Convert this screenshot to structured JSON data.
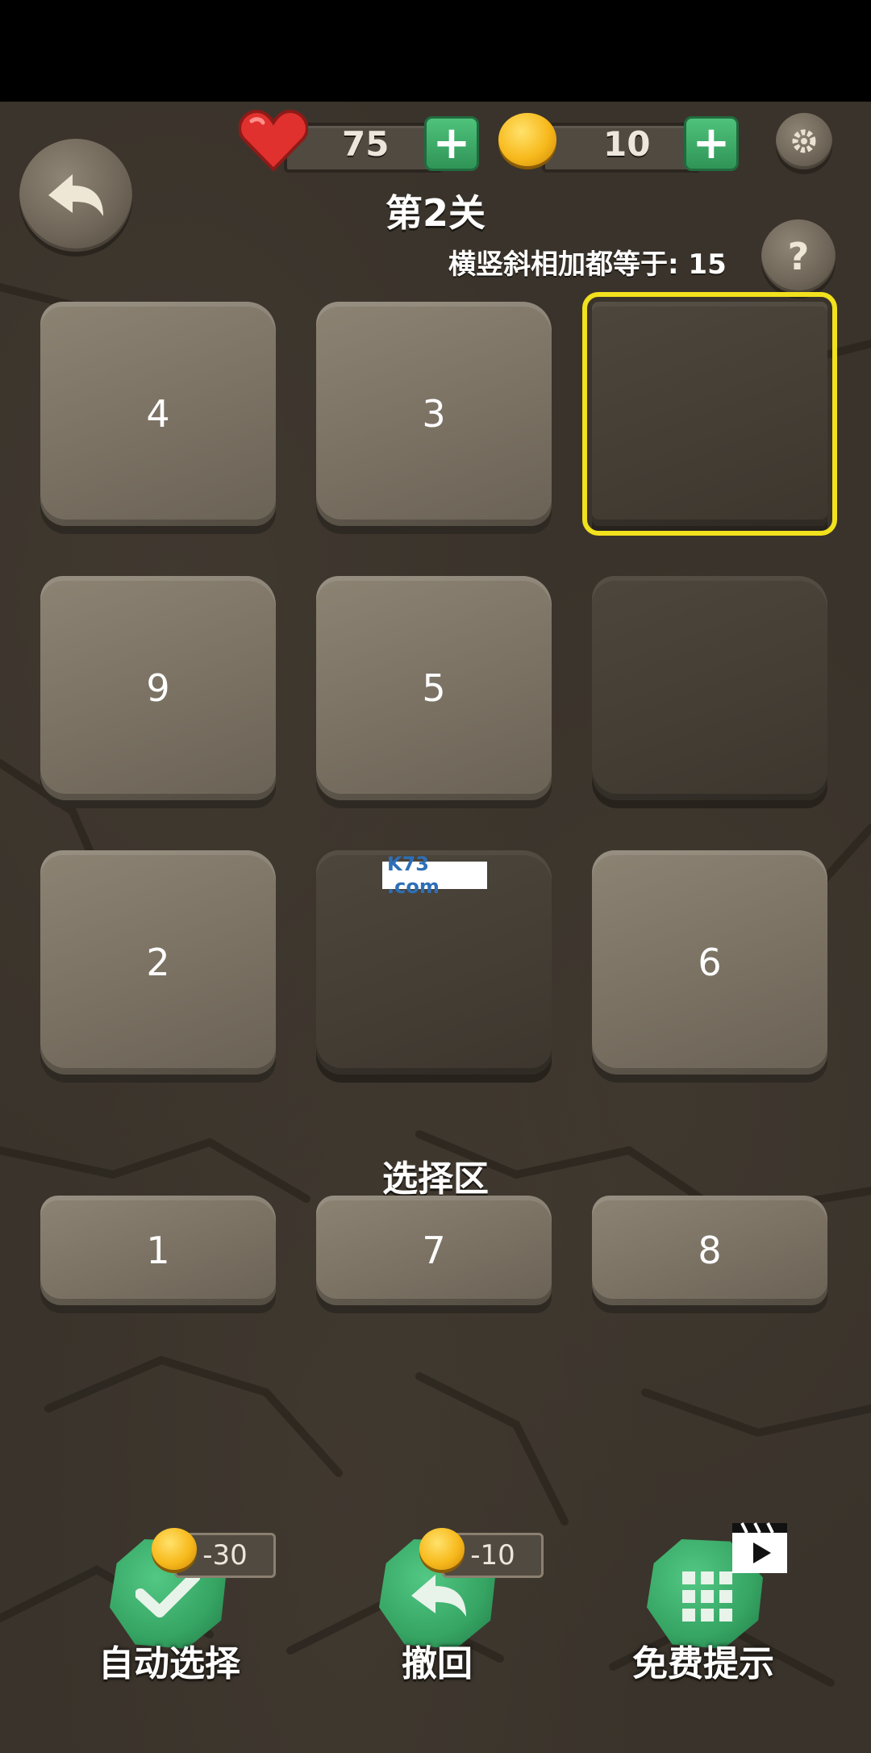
{
  "stats": {
    "lives": "75",
    "coins": "10",
    "plus_symbol": "+"
  },
  "level": {
    "title": "第2关",
    "rule": "横竖斜相加都等于: 15",
    "help_symbol": "?"
  },
  "board": {
    "cells": [
      "4",
      "3",
      "",
      "9",
      "5",
      "",
      "2",
      "",
      "6"
    ],
    "selected_index": 2
  },
  "selection": {
    "title": "选择区",
    "options": [
      "1",
      "7",
      "8"
    ]
  },
  "actions": [
    {
      "label": "自动选择",
      "cost": "-30",
      "icon": "check-icon"
    },
    {
      "label": "撤回",
      "cost": "-10",
      "icon": "undo-arrow-icon"
    },
    {
      "label": "免费提示",
      "cost": "",
      "icon": "grid-icon"
    }
  ],
  "watermark": "K73 .com",
  "colors": {
    "highlight": "#f2e11d",
    "button_green": "#36a463",
    "coin_gold": "#f7b91c",
    "heart_red": "#e0312e"
  }
}
